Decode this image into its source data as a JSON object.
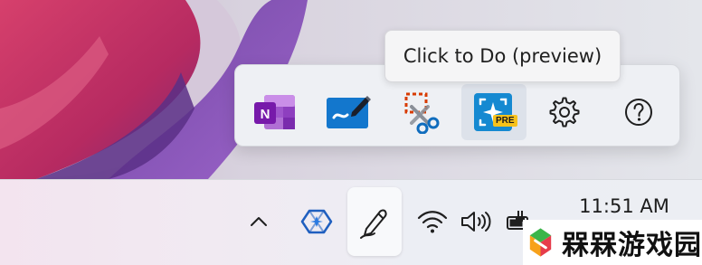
{
  "tooltip": {
    "text": "Click to Do (preview)"
  },
  "flyout": {
    "items": [
      {
        "name": "OneNote",
        "icon": "onenote-icon"
      },
      {
        "name": "Whiteboard",
        "icon": "whiteboard-icon"
      },
      {
        "name": "Snipping Tool",
        "icon": "snipping-tool-icon"
      },
      {
        "name": "Click to Do (preview)",
        "icon": "click-to-do-icon",
        "badge": "PRE",
        "selected": true
      },
      {
        "name": "Settings",
        "icon": "gear-icon"
      },
      {
        "name": "Help",
        "icon": "help-icon"
      }
    ]
  },
  "taskbar": {
    "tray": [
      {
        "icon": "chevron-up-icon"
      },
      {
        "icon": "copilot-icon"
      },
      {
        "icon": "pen-icon"
      },
      {
        "icon": "wifi-icon"
      },
      {
        "icon": "speaker-icon"
      },
      {
        "icon": "battery-charging-icon"
      }
    ],
    "clock": "11:51 AM"
  },
  "watermark": {
    "text": "槑槑游戏园"
  },
  "colors": {
    "onenote": "#7719aa",
    "whiteboard": "#0f6cbd",
    "accent": "#0f6cbd",
    "badge": "#f7c21b"
  }
}
